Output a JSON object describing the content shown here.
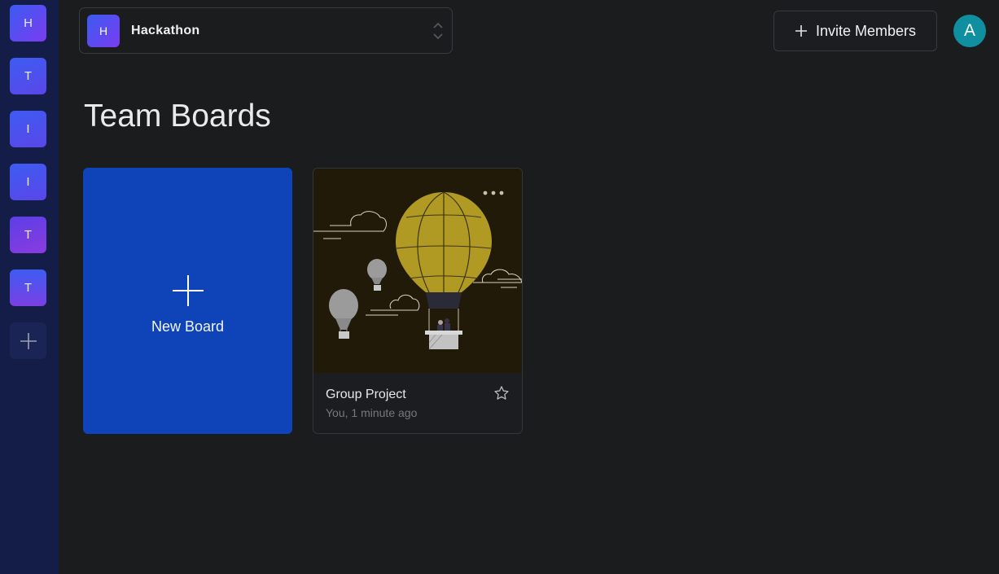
{
  "sidebar": {
    "workspaces": [
      {
        "letter": "H"
      },
      {
        "letter": "T"
      },
      {
        "letter": "I"
      },
      {
        "letter": "I"
      },
      {
        "letter": "T"
      },
      {
        "letter": "T"
      }
    ],
    "add_icon": "plus-icon"
  },
  "header": {
    "org": {
      "initial": "H",
      "name": "Hackathon",
      "icon": "chevron-up-down-icon"
    },
    "invite_label": "Invite Members",
    "invite_icon": "plus-icon",
    "user_initial": "A"
  },
  "main": {
    "title": "Team Boards",
    "new_board_label": "New Board",
    "boards": [
      {
        "name": "Group Project",
        "meta": "You, 1 minute ago",
        "icon": "star-icon"
      }
    ]
  },
  "colors": {
    "background": "#1b1c1e",
    "sidebar": "#141d47",
    "new_board": "#0f43b8",
    "user_avatar": "#0f8fa0",
    "balloon": "#b09a24"
  }
}
